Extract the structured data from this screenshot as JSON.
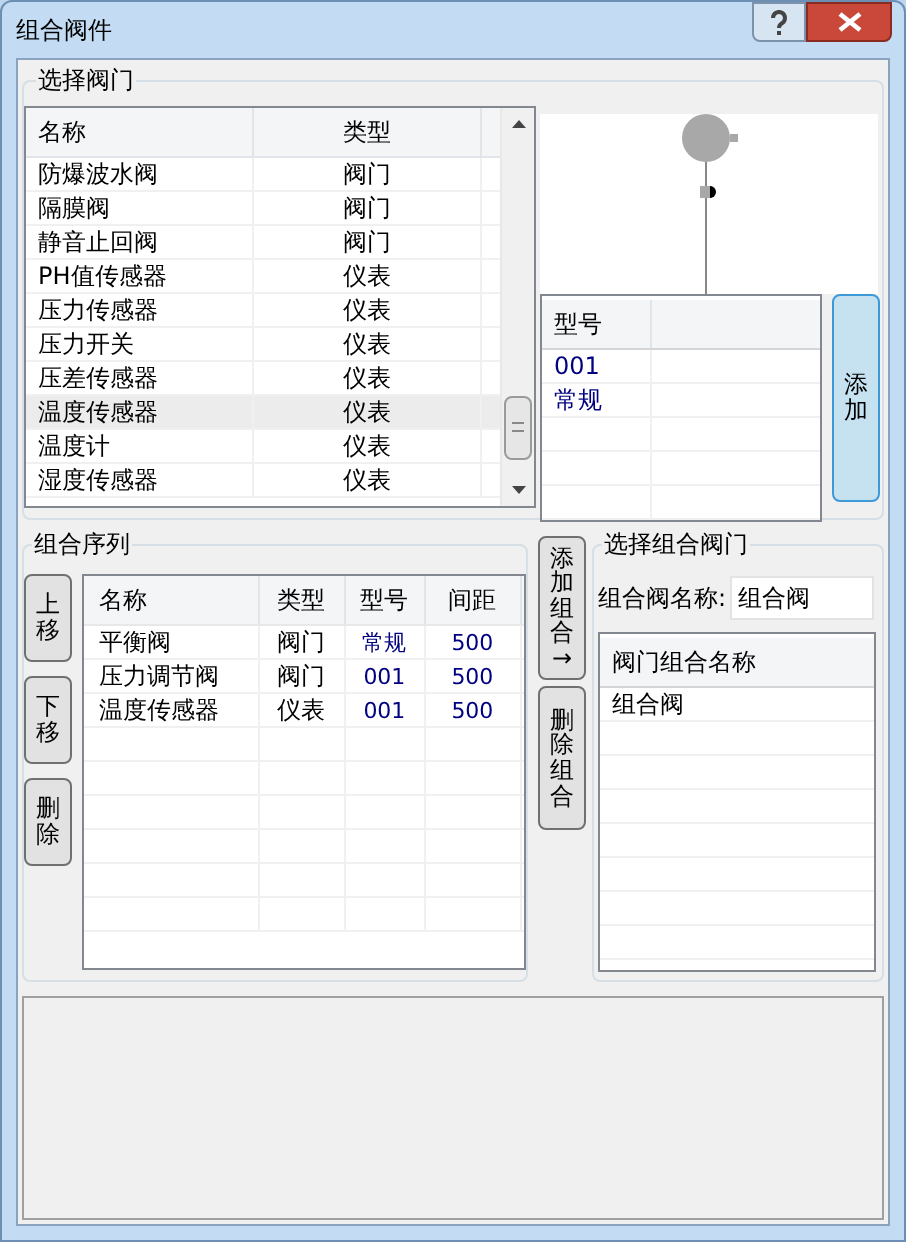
{
  "window": {
    "title": "组合阀件"
  },
  "valve_group": {
    "title": "选择阀门",
    "columns": [
      "名称",
      "类型"
    ],
    "rows": [
      {
        "name": "防爆波水阀",
        "type": "阀门",
        "selected": false
      },
      {
        "name": "隔膜阀",
        "type": "阀门",
        "selected": false
      },
      {
        "name": "静音止回阀",
        "type": "阀门",
        "selected": false
      },
      {
        "name": "PH值传感器",
        "type": "仪表",
        "selected": false
      },
      {
        "name": "压力传感器",
        "type": "仪表",
        "selected": false
      },
      {
        "name": "压力开关",
        "type": "仪表",
        "selected": false
      },
      {
        "name": "压差传感器",
        "type": "仪表",
        "selected": false
      },
      {
        "name": "温度传感器",
        "type": "仪表",
        "selected": true
      },
      {
        "name": "温度计",
        "type": "仪表",
        "selected": false
      },
      {
        "name": "湿度传感器",
        "type": "仪表",
        "selected": false
      }
    ],
    "model_column": "型号",
    "models": [
      "001",
      "常规"
    ],
    "add_button": "添加"
  },
  "sequence_group": {
    "title": "组合序列",
    "buttons": [
      "上移",
      "下移",
      "删除"
    ],
    "columns": [
      "名称",
      "类型",
      "型号",
      "间距"
    ],
    "rows": [
      [
        "平衡阀",
        "阀门",
        "常规",
        "500"
      ],
      [
        "压力调节阀",
        "阀门",
        "001",
        "500"
      ],
      [
        "温度传感器",
        "仪表",
        "001",
        "500"
      ]
    ]
  },
  "middle_buttons": [
    "添加组合→",
    "删除组合"
  ],
  "combo_group": {
    "title": "选择组合阀门",
    "name_label": "组合阀名称:",
    "name_value": "组合阀",
    "list_column": "阀门组合名称",
    "items": [
      "组合阀"
    ]
  }
}
